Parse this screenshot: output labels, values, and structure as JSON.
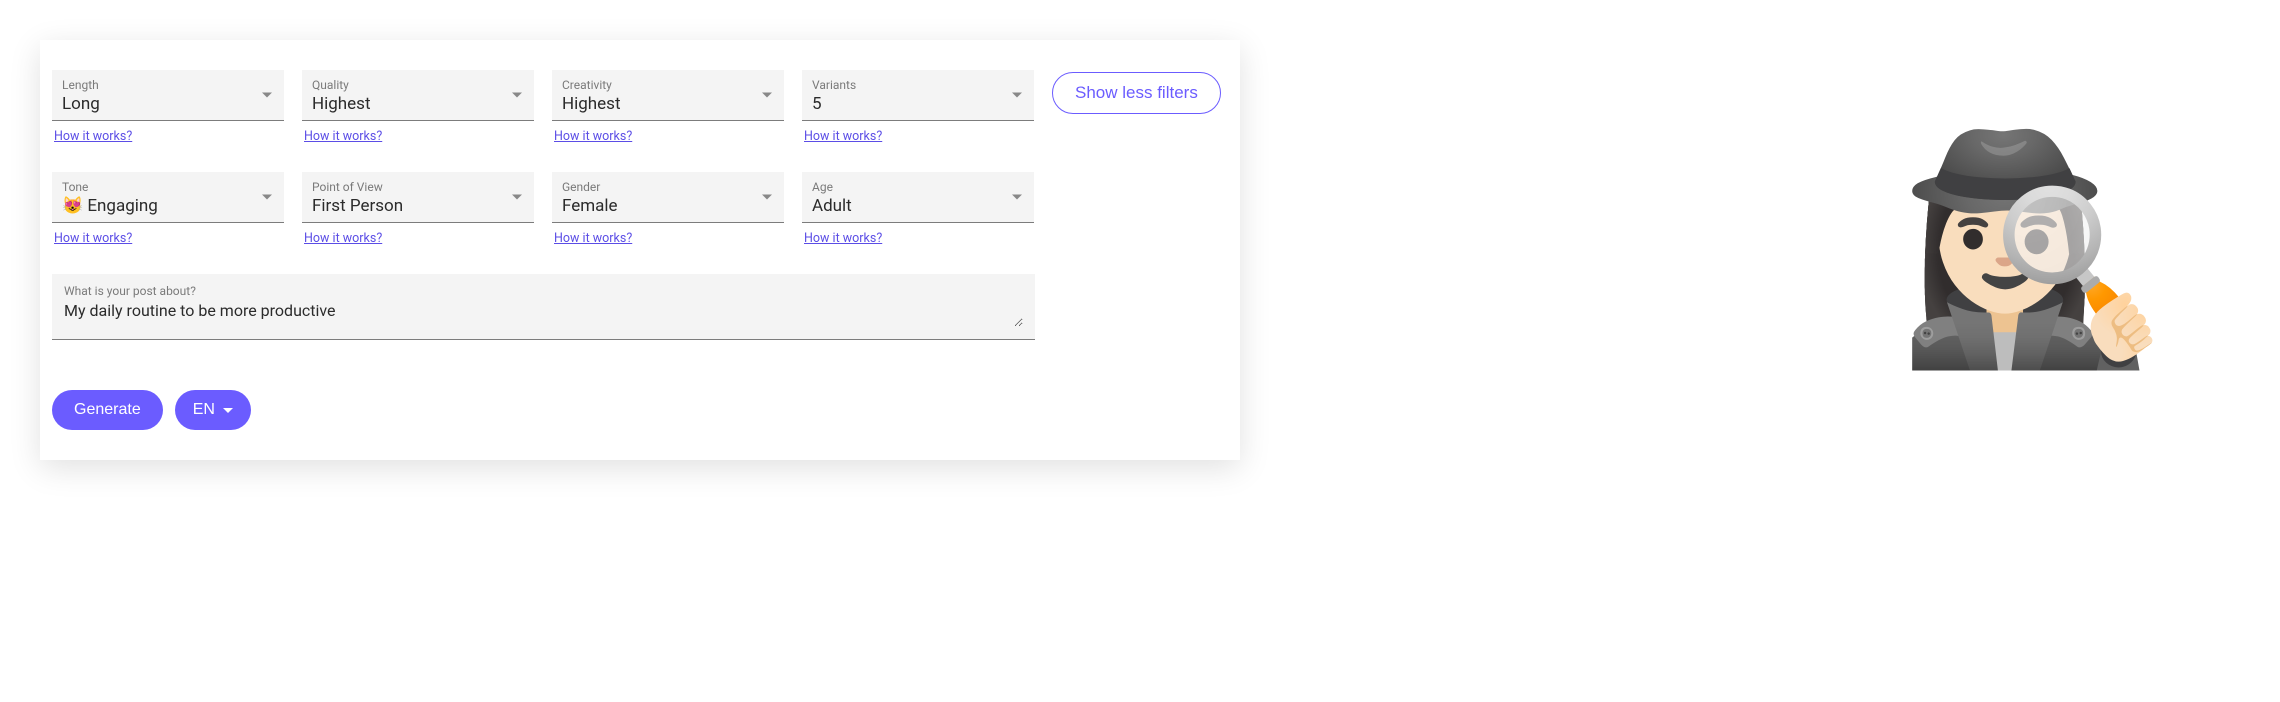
{
  "filters": {
    "length": {
      "label": "Length",
      "value": "Long"
    },
    "quality": {
      "label": "Quality",
      "value": "Highest"
    },
    "creativity": {
      "label": "Creativity",
      "value": "Highest"
    },
    "variants": {
      "label": "Variants",
      "value": "5"
    },
    "tone": {
      "label": "Tone",
      "value": "😻 Engaging"
    },
    "pov": {
      "label": "Point of View",
      "value": "First Person"
    },
    "gender": {
      "label": "Gender",
      "value": "Female"
    },
    "age": {
      "label": "Age",
      "value": "Adult"
    }
  },
  "how_it_works": "How it works?",
  "show_less": "Show less filters",
  "prompt": {
    "label": "What is your post about?",
    "value": "My daily routine to be more productive"
  },
  "buttons": {
    "generate": "Generate",
    "language": "EN"
  },
  "mascot_icon": "🕵🏻‍♀️"
}
